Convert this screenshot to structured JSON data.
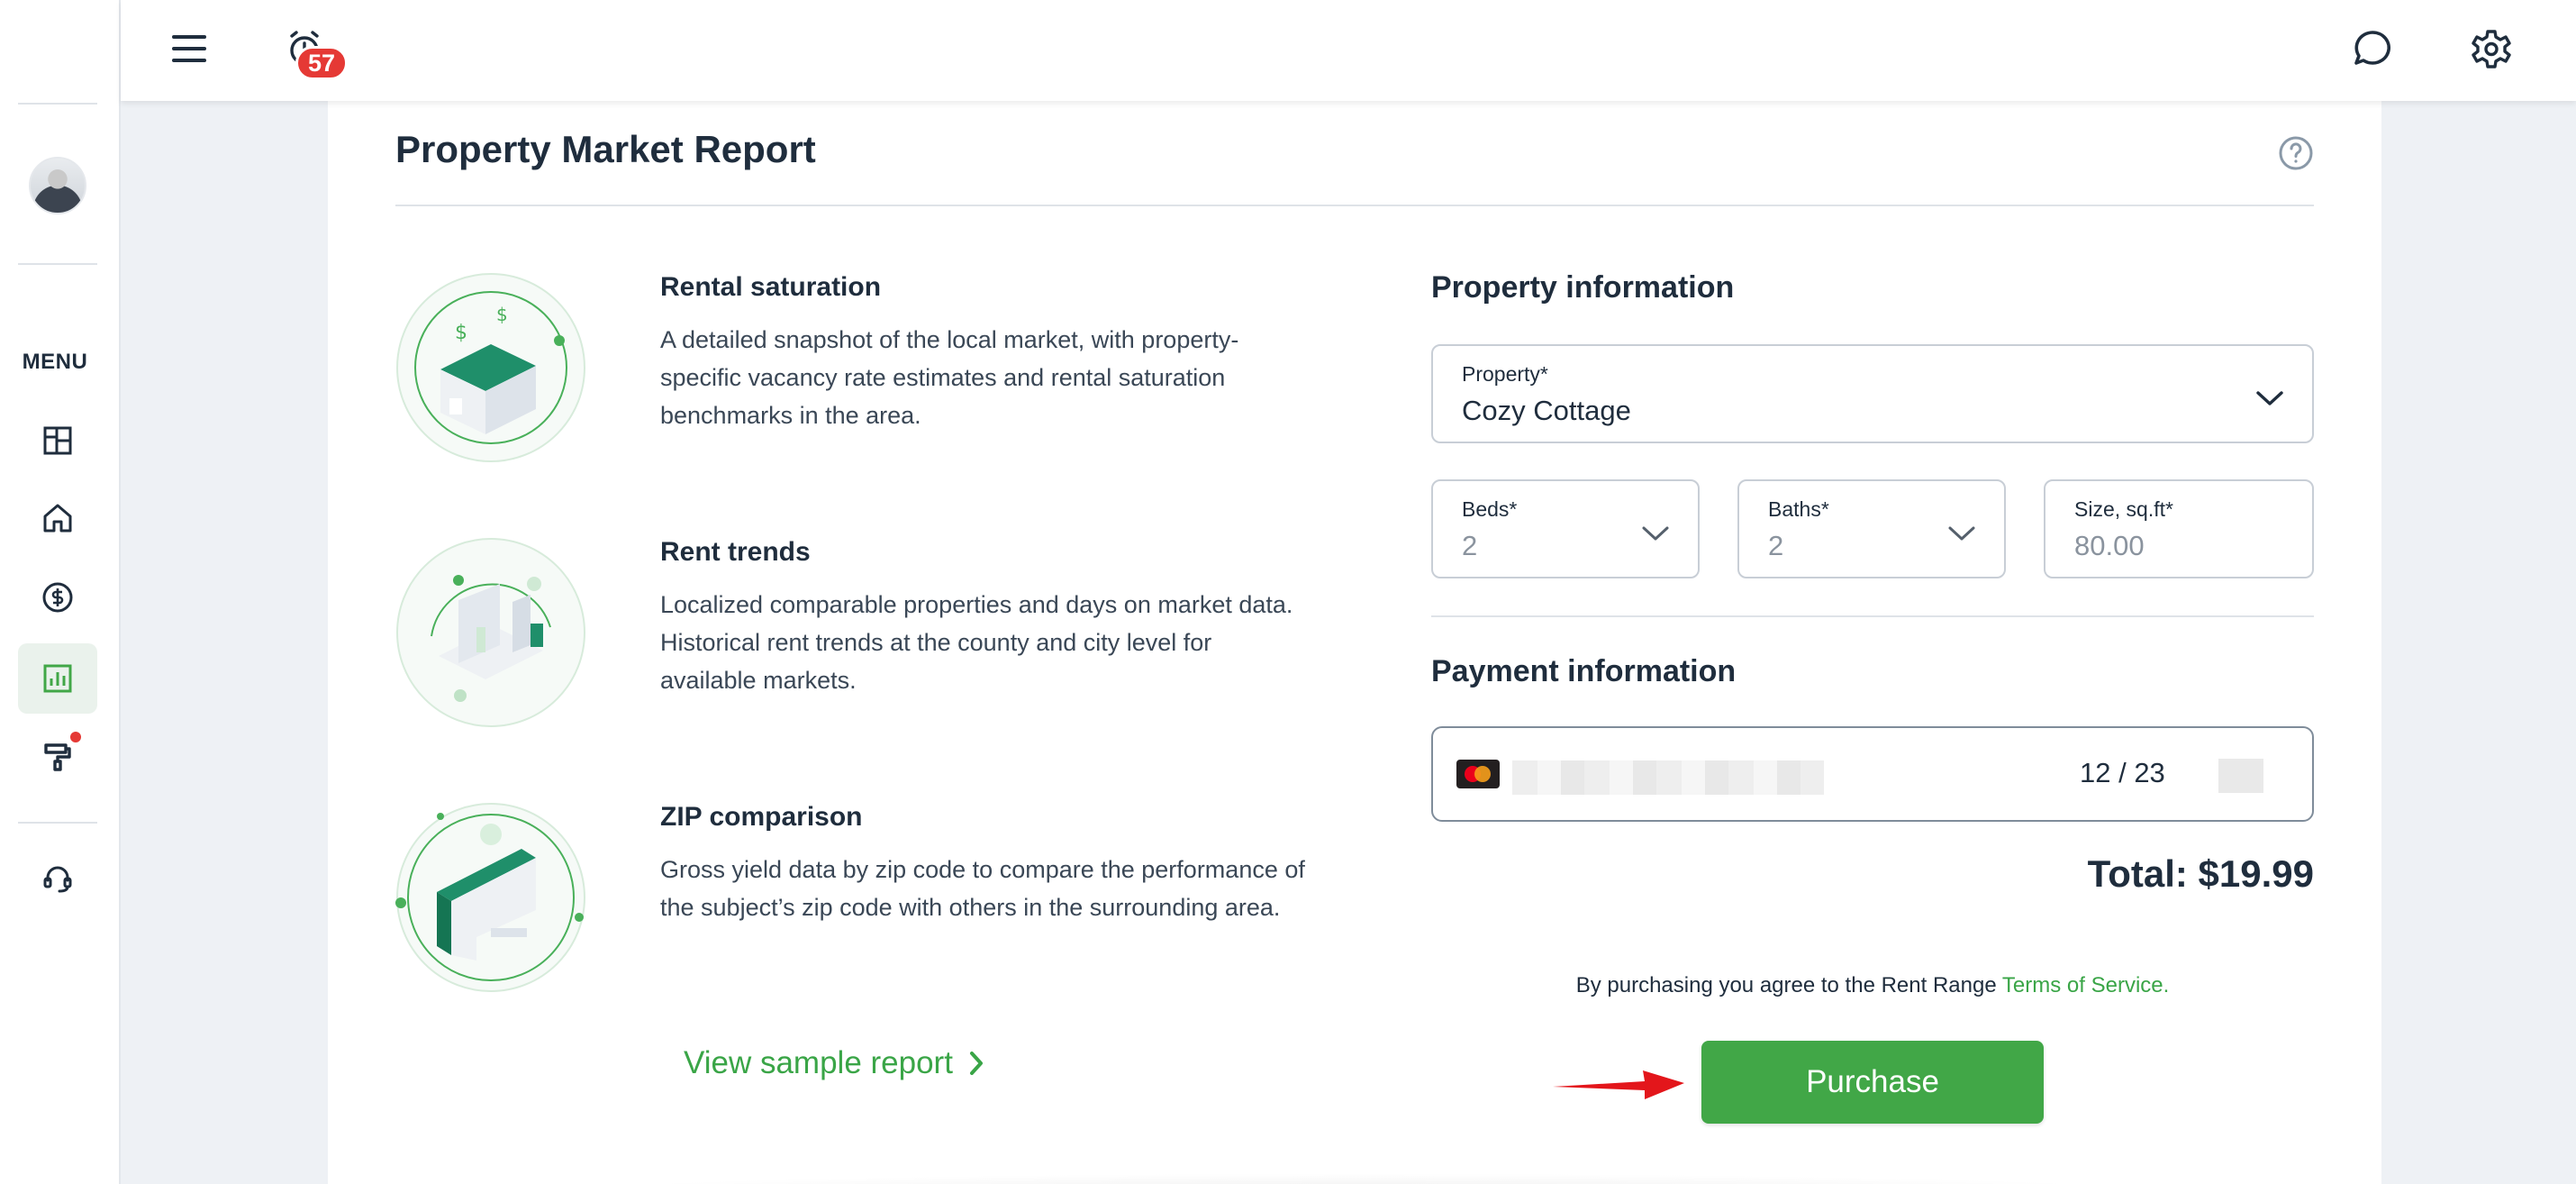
{
  "topbar": {
    "notification_count": "57"
  },
  "sidebar": {
    "menu_label": "MENU"
  },
  "page": {
    "title": "Property Market Report"
  },
  "features": [
    {
      "title": "Rental saturation",
      "description": "A detailed snapshot of the local market, with property-specific vacancy rate estimates and rental saturation benchmarks in the area."
    },
    {
      "title": "Rent trends",
      "description": "Localized comparable properties and days on market data. Historical rent trends at the county and city level for available markets."
    },
    {
      "title": "ZIP comparison",
      "description": "Gross yield data by zip code to compare the performance of the subject’s zip code with others in the surrounding area."
    }
  ],
  "sample_link": "View sample report",
  "property_info": {
    "section_title": "Property information",
    "property_label": "Property*",
    "property_value": "Cozy Cottage",
    "beds_label": "Beds*",
    "beds_value": "2",
    "baths_label": "Baths*",
    "baths_value": "2",
    "size_label": "Size, sq.ft*",
    "size_placeholder": "80.00"
  },
  "payment_info": {
    "section_title": "Payment information",
    "card_expiry": "12 / 23"
  },
  "total": "Total: $19.99",
  "terms": {
    "prefix": "By purchasing you agree to the Rent Range ",
    "link": "Terms of Service."
  },
  "purchase_button": "Purchase",
  "colors": {
    "accent_green": "#41a747",
    "badge_red": "#e53935",
    "text_dark": "#1f2d3d"
  }
}
